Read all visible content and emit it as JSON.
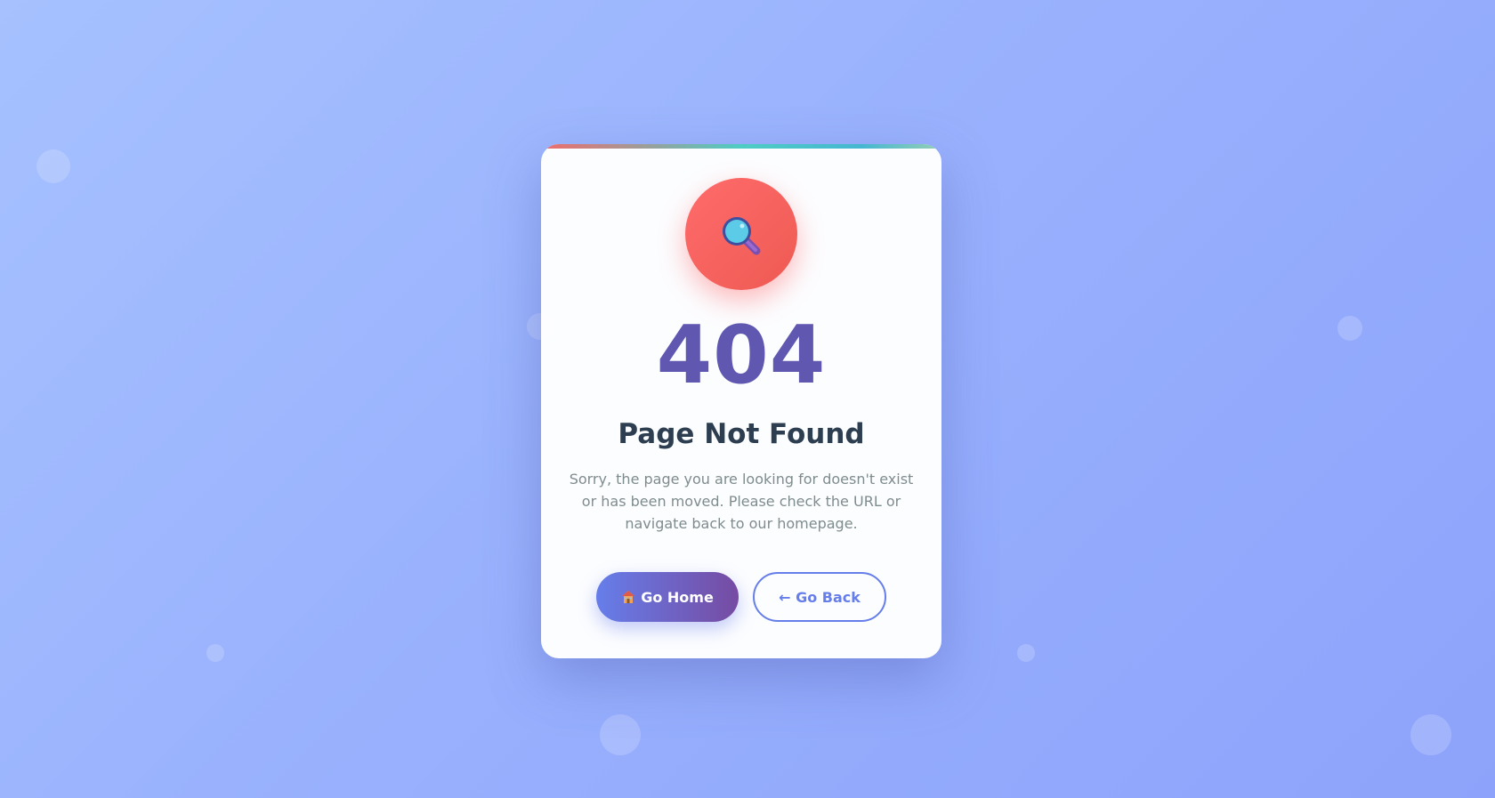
{
  "error": {
    "code": "404",
    "title": "Page Not Found",
    "message": "Sorry, the page you are looking for doesn't exist or has been moved. Please check the URL or navigate back to our homepage."
  },
  "icon": "magnifying-glass-icon",
  "actions": {
    "home_label": "Go Home",
    "home_icon": "house-icon",
    "back_label": "← Go Back"
  },
  "colors": {
    "accent_start": "#667eea",
    "accent_end": "#764ba2",
    "icon_circle": "#ff6b6b",
    "code_text": "#5f57b0",
    "title_text": "#2c3e50",
    "message_text": "#7f8c8d"
  }
}
